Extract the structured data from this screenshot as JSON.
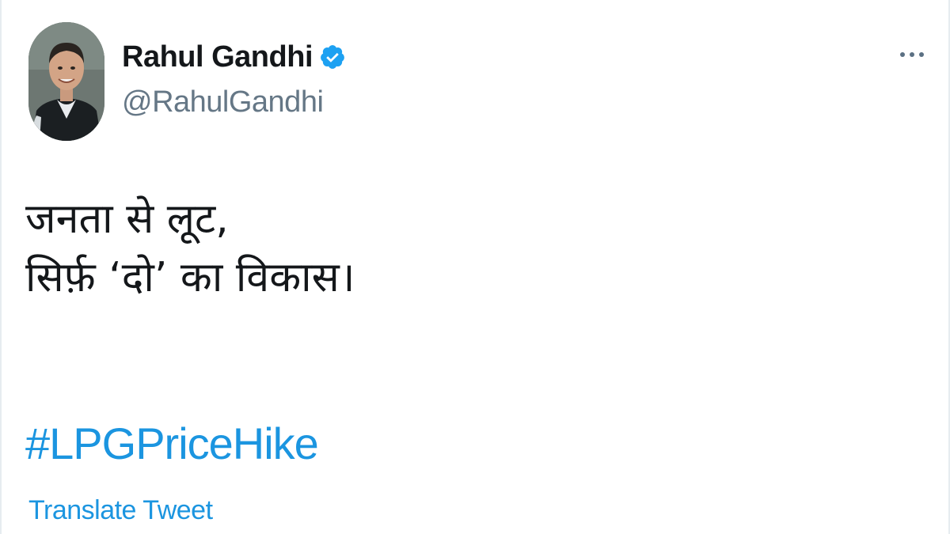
{
  "tweet": {
    "author": {
      "name": "Rahul Gandhi",
      "handle": "@RahulGandhi",
      "verified": true,
      "avatar_icon": "profile-photo"
    },
    "more_icon": "more-horizontal-icon",
    "text_lines": [
      "जनता से लूट,",
      "सिर्फ़ ‘दो’ का विकास।"
    ],
    "hashtag": "#LPGPriceHike",
    "translate_label": "Translate Tweet"
  },
  "colors": {
    "link": "#1b95e0",
    "verified": "#1da1f2",
    "text": "#14171a",
    "secondary": "#657786"
  }
}
